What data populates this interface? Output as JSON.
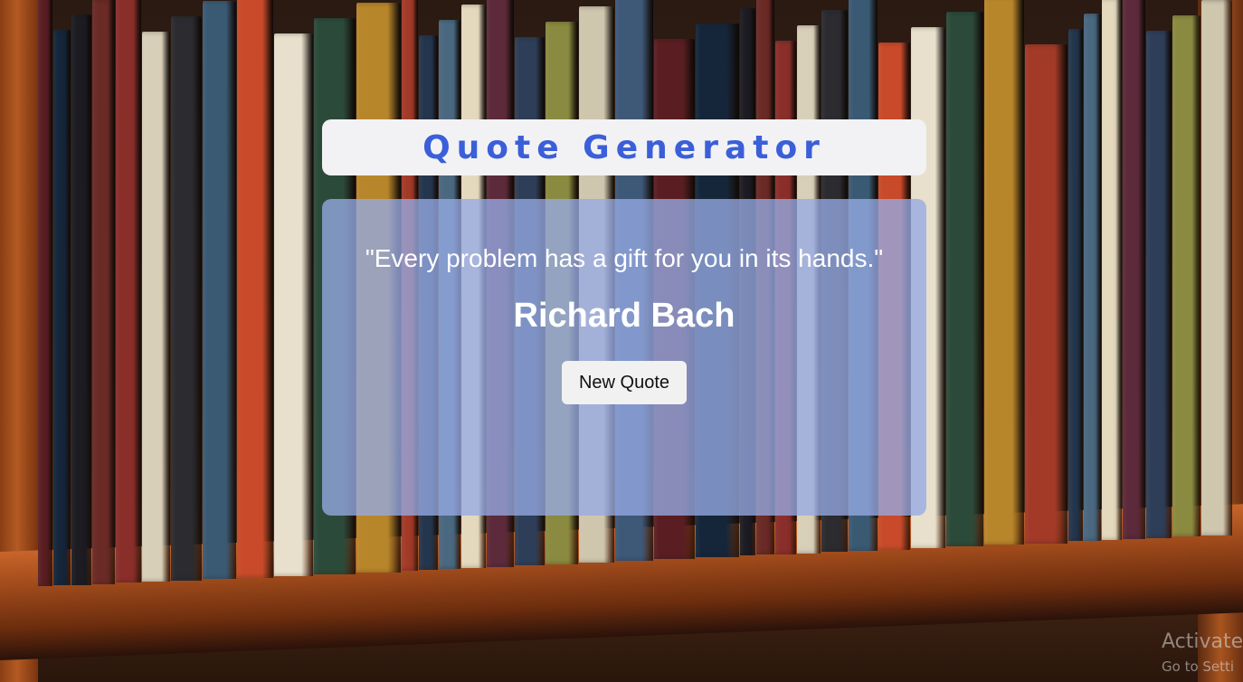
{
  "header": {
    "title": "Quote Generator"
  },
  "quote": {
    "text": "\"Every problem has a gift for you in its hands.\"",
    "author": "Richard Bach"
  },
  "controls": {
    "new_quote_label": "New Quote"
  },
  "watermark": {
    "line1": "Activate",
    "line2": "Go to Setti"
  },
  "colors": {
    "title_color": "#3b5fd9",
    "card_bg": "rgba(150,170,228,0.78)",
    "title_bg": "#f2f2f4"
  }
}
